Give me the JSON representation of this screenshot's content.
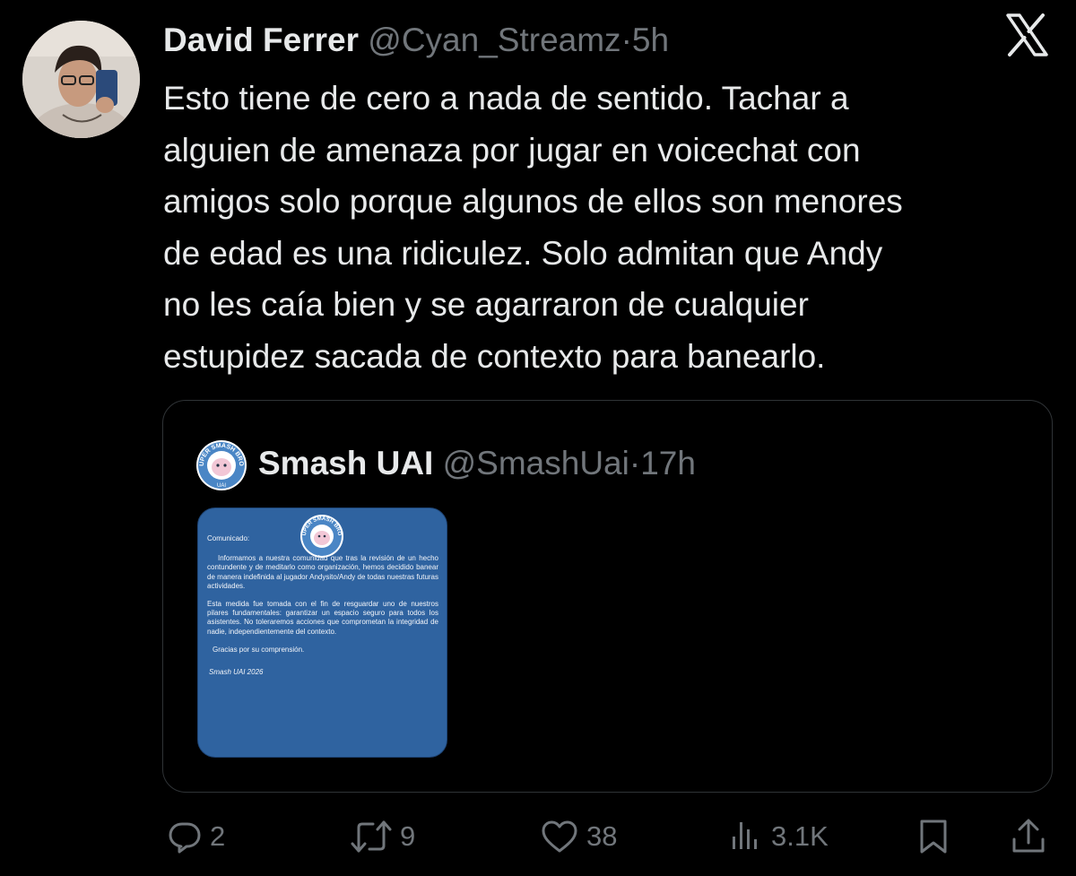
{
  "tweet": {
    "author_name": "David Ferrer",
    "handle": "@Cyan_Streamz",
    "separator": "·",
    "time": "5h",
    "text": "Esto tiene de cero a nada de sentido. Tachar a\nalguien de amenaza por jugar en voicechat con\namigos solo porque algunos de ellos son menores\nde edad es una ridiculez. Solo admitan que Andy\nno les caía bien y se agarraron de cualquier\nestupidez sacada de contexto para banearlo."
  },
  "quoted": {
    "author_name": "Smash UAI",
    "handle": "@SmashUai",
    "separator": "·",
    "time": "17h",
    "logo_text": "SUPER SMASH BROS · UAI",
    "image": {
      "heading": "Comunicado:",
      "paragraph1": "Informamos a nuestra comunidad que tras la revisión de un hecho contundente y de meditarlo como organización, hemos decidido banear de manera indefinida al jugador Andysito/Andy de todas nuestras futuras actividades.",
      "paragraph2": "Esta medida fue tomada con el fin de resguardar uno de nuestros pilares fundamentales: garantizar un espacio seguro para todos los asistentes. No toleraremos acciones que comprometan la integridad de nadie, independientemente del contexto.",
      "thanks": "Gracias por su comprensión.",
      "signature": "Smash UAI 2026"
    }
  },
  "actions": {
    "replies": "2",
    "retweets": "9",
    "likes": "38",
    "views": "3.1K"
  },
  "icons": [
    "reply-icon",
    "retweet-icon",
    "like-icon",
    "views-icon",
    "bookmark-icon",
    "share-icon",
    "x-logo-icon"
  ],
  "colors": {
    "background": "#000000",
    "text_primary": "#e7e9ea",
    "text_secondary": "#71767b",
    "border": "#2f3336",
    "image_blue": "#2f63a0"
  }
}
